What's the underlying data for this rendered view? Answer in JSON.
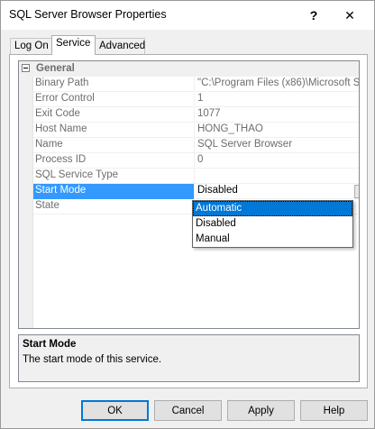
{
  "window": {
    "title": "SQL Server Browser Properties",
    "help_button": "?",
    "close_button": "✕"
  },
  "tabs": [
    {
      "label": "Log On"
    },
    {
      "label": "Service",
      "active": true
    },
    {
      "label": "Advanced"
    }
  ],
  "grid": {
    "category": "General",
    "properties": [
      {
        "name": "Binary Path",
        "value": "\"C:\\Program Files (x86)\\Microsoft S"
      },
      {
        "name": "Error Control",
        "value": "1"
      },
      {
        "name": "Exit Code",
        "value": "1077"
      },
      {
        "name": "Host Name",
        "value": "HONG_THAO"
      },
      {
        "name": "Name",
        "value": "SQL Server Browser"
      },
      {
        "name": "Process ID",
        "value": "0"
      },
      {
        "name": "SQL Service Type",
        "value": ""
      },
      {
        "name": "Start Mode",
        "value": "Disabled"
      },
      {
        "name": "State",
        "value": ""
      }
    ],
    "dropdown_options": [
      "Automatic",
      "Disabled",
      "Manual"
    ],
    "dropdown_arrow": "▼"
  },
  "description": {
    "title": "Start Mode",
    "text": "The start mode of this service."
  },
  "buttons": {
    "ok": "OK",
    "cancel": "Cancel",
    "apply": "Apply",
    "help": "Help"
  }
}
